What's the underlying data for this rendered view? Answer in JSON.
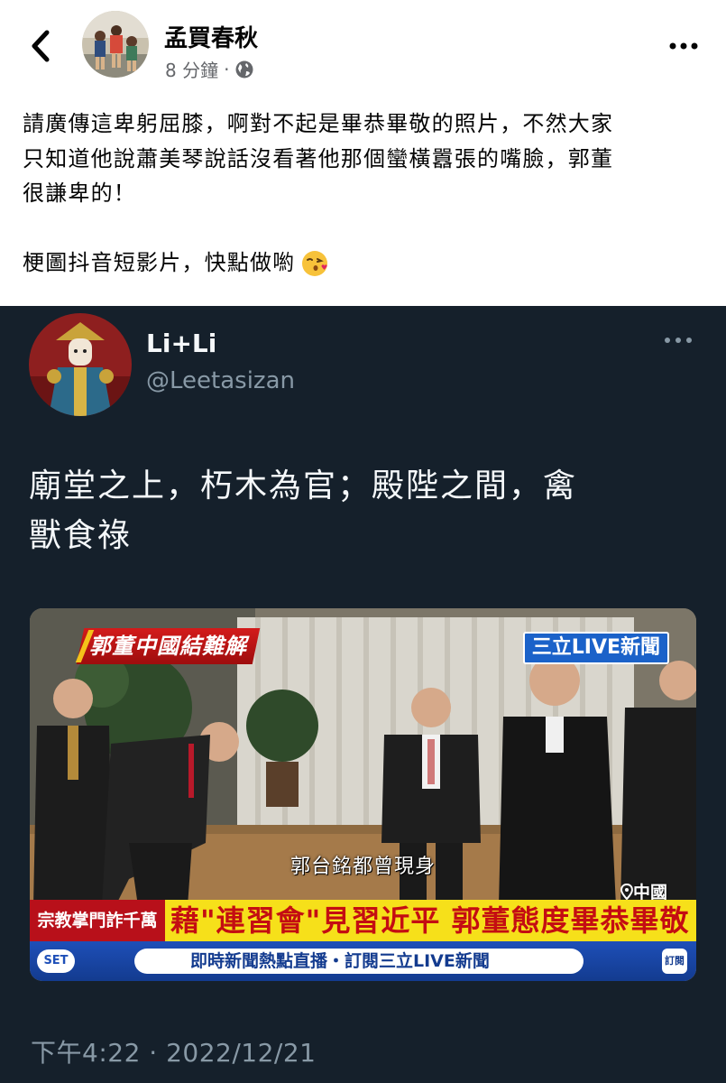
{
  "post": {
    "author": "孟買春秋",
    "time": "8 分鐘",
    "separator": "·",
    "paragraph1": [
      "請廣傳這卑躬屈膝，啊對不起是畢恭畢敬的照片，不然大家",
      "只知道他說蕭美琴說話沒看著他那個蠻橫囂張的嘴臉，郭董",
      "很謙卑的！"
    ],
    "paragraph2": "梗圖抖音短影片，快點做喲"
  },
  "tweet": {
    "name": "Li+Li",
    "handle": "@Leetasizan",
    "text_lines": [
      "廟堂之上，朽木為官；殿陛之間，禽",
      "獸食祿"
    ],
    "timestamp": "下午4:22 · 2022/12/21",
    "media": {
      "top_banner": "郭董中國結難解",
      "channel": "三立LIVE新聞",
      "subtitle": "郭台銘都曾現身",
      "location": "中國",
      "ticker_left": "宗教掌門詐千萬",
      "ticker_main": "藉\"連習會\"見習近平 郭董態度畢恭畢敬",
      "bottom_logo": "SET",
      "bottom_bar": "即時新聞熱點直播・訂閱三立LIVE新聞",
      "subscribe_icon": "訂閱"
    }
  },
  "icons": {
    "back": "chevron-left-icon",
    "more": "more-horizontal-icon",
    "globe": "globe-icon",
    "emoji": "kissing-face-emoji",
    "tweet_more": "more-horizontal-icon"
  }
}
